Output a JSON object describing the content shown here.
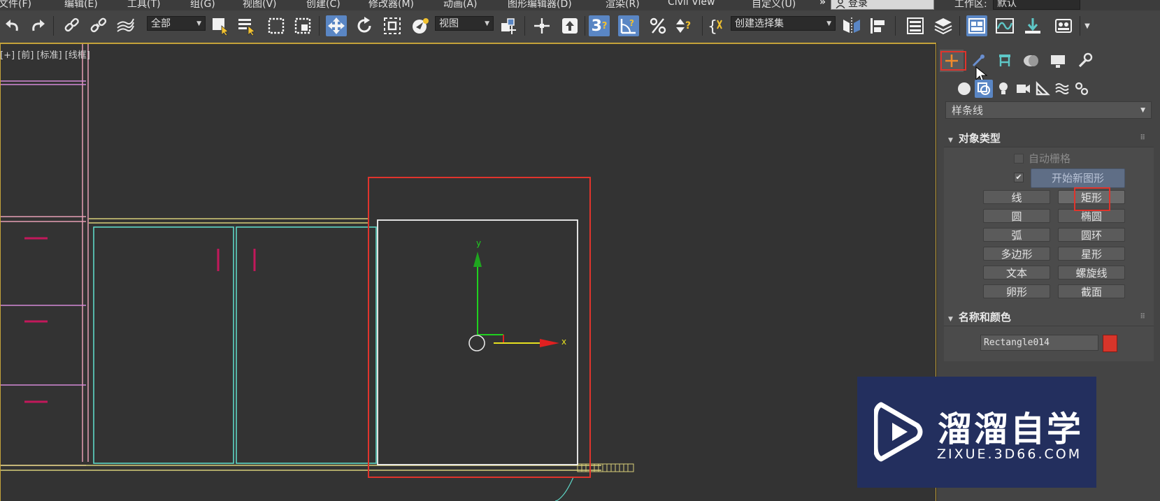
{
  "menu": [
    "文件(F)",
    "编辑(E)",
    "工具(T)",
    "组(G)",
    "视图(V)",
    "创建(C)",
    "修改器(M)",
    "动画(A)",
    "图形编辑器(D)",
    "渲染(R)",
    "Civil View",
    "自定义(U)"
  ],
  "menu_overflow": "»",
  "login": {
    "label": "登录"
  },
  "workspace": {
    "label": "工作区:",
    "value": "默认"
  },
  "toolbar": {
    "selection_filter": "全部",
    "ref_coord": "视图",
    "snap_3d": "3",
    "named_selection": "创建选择集"
  },
  "viewport": {
    "labels": "[+] [前] [标准] [线框]",
    "axis_x": "x",
    "axis_y": "y"
  },
  "command_panel": {
    "category": "样条线",
    "rollout_object_type": {
      "title": "对象类型",
      "auto_grid": "自动栅格",
      "start_new_shape": "开始新图形",
      "start_new_shape_checked": true,
      "buttons": [
        "线",
        "矩形",
        "圆",
        "椭圆",
        "弧",
        "圆环",
        "多边形",
        "星形",
        "文本",
        "螺旋线",
        "卵形",
        "截面"
      ]
    },
    "rollout_name_color": {
      "title": "名称和颜色",
      "object_name": "Rectangle014",
      "object_color": "#d8352a"
    }
  },
  "watermark": {
    "title": "溜溜自学",
    "url": "ZIXUE.3D66.COM"
  },
  "colors": {
    "highlight": "#e0342c",
    "selected_toolbar": "#5a86c4",
    "viewport_bg": "#333333"
  }
}
